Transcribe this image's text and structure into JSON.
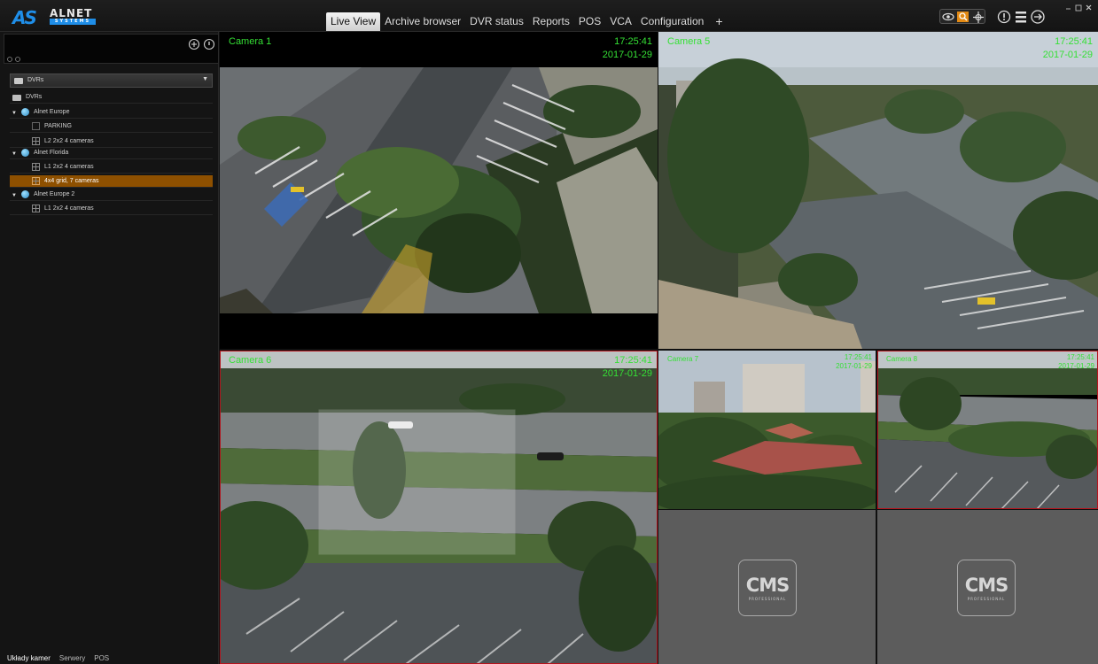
{
  "app": {
    "logo_text": "AS",
    "brand_name": "ALNET",
    "brand_sub": "SYSTEMS"
  },
  "tabs": [
    {
      "label": "Live View",
      "active": true
    },
    {
      "label": "Archive browser"
    },
    {
      "label": "DVR status"
    },
    {
      "label": "Reports"
    },
    {
      "label": "POS"
    },
    {
      "label": "VCA"
    },
    {
      "label": "Configuration"
    },
    {
      "label": "+"
    }
  ],
  "sidebar": {
    "dvr_select": "DVRs",
    "tree": [
      {
        "label": "DVRs",
        "type": "folder"
      },
      {
        "label": "Alnet Europe",
        "type": "server"
      },
      {
        "label": "PARKING",
        "type": "view"
      },
      {
        "label": "L2 2x2 4 cameras",
        "type": "grid"
      },
      {
        "label": "Alnet Florida",
        "type": "server"
      },
      {
        "label": "L1 2x2 4 cameras",
        "type": "grid"
      },
      {
        "label": "4x4 grid, 7 cameras",
        "type": "grid",
        "selected": true
      },
      {
        "label": "Alnet Europe 2",
        "type": "server"
      },
      {
        "label": "L1 2x2 4 cameras",
        "type": "grid"
      }
    ],
    "bottom_tabs": [
      "Układy kamer",
      "Serwery",
      "POS"
    ]
  },
  "cameras": [
    {
      "name": "Camera 1",
      "time": "17:25:41",
      "date": "2017-01-29"
    },
    {
      "name": "Camera 5",
      "time": "17:25:41",
      "date": "2017-01-29"
    },
    {
      "name": "Camera 6",
      "time": "17:25:41",
      "date": "2017-01-29"
    },
    {
      "name": "Camera 7",
      "time": "17:25:41",
      "date": "2017-01-29"
    },
    {
      "name": "Camera 8",
      "time": "17:25:41",
      "date": "2017-01-29"
    }
  ],
  "placeholder": {
    "logo": "CMS",
    "sub": "PROFESSIONAL"
  },
  "icons": {
    "eye": "eye-icon",
    "search": "search-icon",
    "crosshair": "crosshair-icon",
    "info": "info-icon",
    "menu": "menu-icon",
    "exit": "exit-icon",
    "minimize": "minimize-icon",
    "restore": "restore-icon",
    "close": "close-icon",
    "add": "add-icon"
  },
  "colors": {
    "accent": "#8e5000",
    "overlay_text": "#35e035",
    "alarm_border": "#b4141d",
    "brand_blue": "#1f8ee8"
  }
}
